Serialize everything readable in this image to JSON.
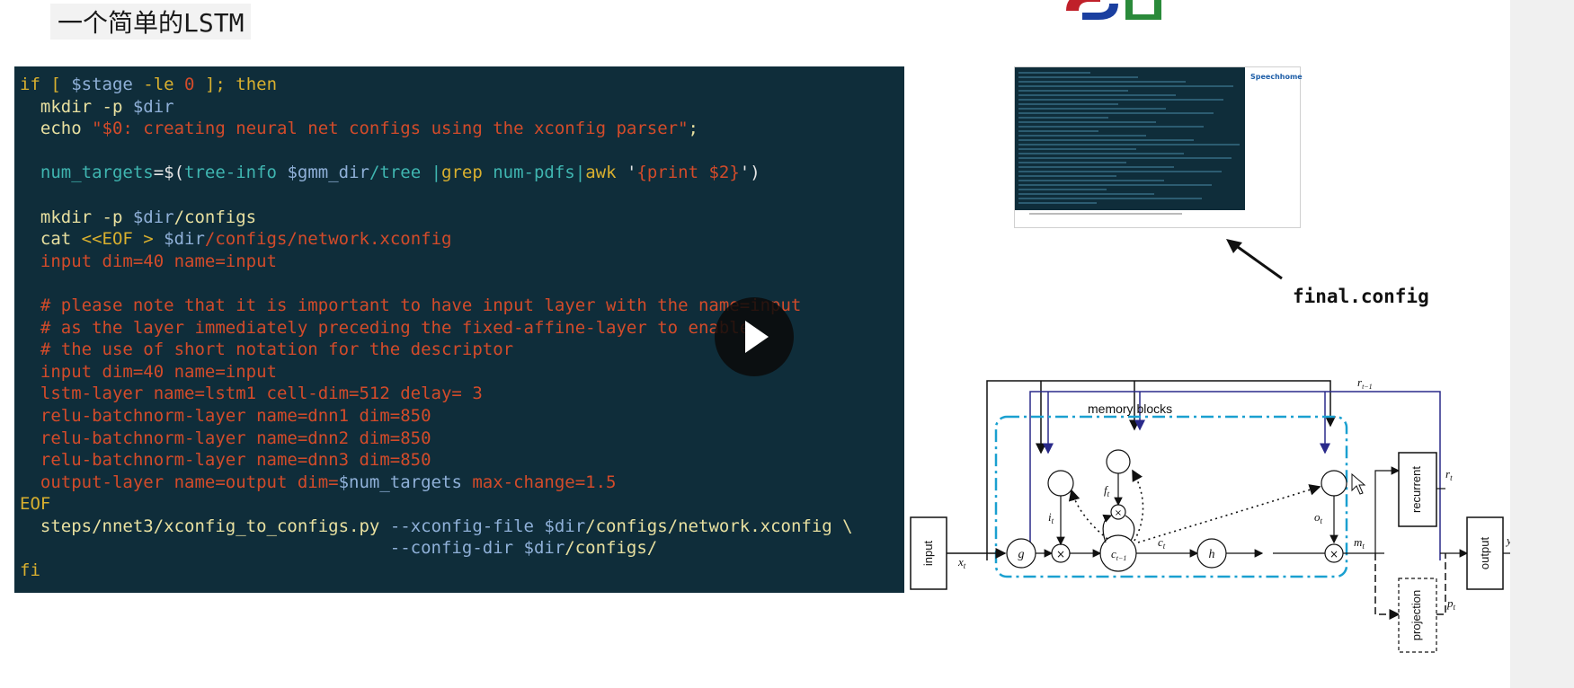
{
  "slide": {
    "title": "一个简单的LSTM"
  },
  "code_lines": [
    [
      {
        "t": "if [ ",
        "c": "kw"
      },
      {
        "t": "$stage",
        "c": "dir"
      },
      {
        "t": " -le ",
        "c": "kw"
      },
      {
        "t": "0",
        "c": "num"
      },
      {
        "t": " ]; then",
        "c": "kw"
      }
    ],
    [
      {
        "t": "  mkdir -p ",
        "c": "cmd"
      },
      {
        "t": "$dir",
        "c": "dir"
      }
    ],
    [
      {
        "t": "  echo ",
        "c": "cmd"
      },
      {
        "t": "\"$0: creating neural net configs using the xconfig parser\"",
        "c": "str"
      },
      {
        "t": ";",
        "c": "cmd"
      }
    ],
    [
      {
        "t": "",
        "c": "plain"
      }
    ],
    [
      {
        "t": "  num_targets",
        "c": "cy"
      },
      {
        "t": "=$(",
        "c": "wh"
      },
      {
        "t": "tree-info ",
        "c": "cy"
      },
      {
        "t": "$gmm_dir",
        "c": "dir"
      },
      {
        "t": "/tree |",
        "c": "cy"
      },
      {
        "t": "grep",
        "c": "kw"
      },
      {
        "t": " num-pdfs|",
        "c": "cy"
      },
      {
        "t": "awk",
        "c": "kw"
      },
      {
        "t": " '",
        "c": "wh"
      },
      {
        "t": "{print $2}",
        "c": "red"
      },
      {
        "t": "')",
        "c": "wh"
      }
    ],
    [
      {
        "t": "",
        "c": "plain"
      }
    ],
    [
      {
        "t": "  mkdir -p ",
        "c": "cmd"
      },
      {
        "t": "$dir",
        "c": "dir"
      },
      {
        "t": "/configs",
        "c": "cmd"
      }
    ],
    [
      {
        "t": "  cat ",
        "c": "cmd"
      },
      {
        "t": "<<EOF > ",
        "c": "kw"
      },
      {
        "t": "$dir",
        "c": "dir"
      },
      {
        "t": "/configs/network.xconfig",
        "c": "red"
      }
    ],
    [
      {
        "t": "  input dim=40 name=input",
        "c": "red"
      }
    ],
    [
      {
        "t": "",
        "c": "plain"
      }
    ],
    [
      {
        "t": "  # please note that it is important to have input layer with the name=input",
        "c": "red"
      }
    ],
    [
      {
        "t": "  # as the layer immediately preceding the fixed-affine-layer to enable",
        "c": "red"
      }
    ],
    [
      {
        "t": "  # the use of short notation for the descriptor",
        "c": "red"
      }
    ],
    [
      {
        "t": "  input dim=40 name=input",
        "c": "red"
      }
    ],
    [
      {
        "t": "  lstm-layer name=lstm1 cell-dim=512 delay= 3",
        "c": "red"
      }
    ],
    [
      {
        "t": "  relu-batchnorm-layer name=dnn1 dim=850",
        "c": "red"
      }
    ],
    [
      {
        "t": "  relu-batchnorm-layer name=dnn2 dim=850",
        "c": "red"
      }
    ],
    [
      {
        "t": "  relu-batchnorm-layer name=dnn3 dim=850",
        "c": "red"
      }
    ],
    [
      {
        "t": "  output-layer name=output dim=",
        "c": "red"
      },
      {
        "t": "$num_targets",
        "c": "dir"
      },
      {
        "t": " max-change=1.5",
        "c": "red"
      }
    ],
    [
      {
        "t": "EOF",
        "c": "kw"
      }
    ],
    [
      {
        "t": "  steps/nnet3/xconfig_to_configs.py ",
        "c": "cmd"
      },
      {
        "t": "--xconfig-file ",
        "c": "dir"
      },
      {
        "t": "$dir",
        "c": "dir"
      },
      {
        "t": "/configs/network.xconfig \\",
        "c": "cmd"
      }
    ],
    [
      {
        "t": "                                    --config-dir ",
        "c": "dir"
      },
      {
        "t": "$dir",
        "c": "dir"
      },
      {
        "t": "/configs/",
        "c": "cmd"
      }
    ],
    [
      {
        "t": "fi",
        "c": "kw"
      }
    ]
  ],
  "thumbnail": {
    "brand": "Speechhome"
  },
  "annotation": {
    "label": "final.config"
  },
  "diagram": {
    "memory_blocks_label": "memory blocks",
    "input_label": "input",
    "output_label": "output",
    "recurrent_label": "recurrent",
    "projection_label": "projection",
    "g_label": "g",
    "h_label": "h",
    "c_prev_label": "c",
    "c_prev_sub": "t−1",
    "ct_label": "c",
    "ct_sub": "t",
    "it_label": "i",
    "it_sub": "t",
    "ft_label": "f",
    "ft_sub": "t",
    "ot_label": "o",
    "ot_sub": "t",
    "xt_label": "x",
    "xt_sub": "t",
    "mt_label": "m",
    "mt_sub": "t",
    "rt_label": "r",
    "rt_sub": "t",
    "rt1_label": "r",
    "rt1_sub": "t−1",
    "pt_label": "p",
    "pt_sub": "t",
    "yt_label": "y",
    "yt_sub": "t",
    "times_symbol": "×"
  },
  "player": {
    "play_icon": "play-icon"
  }
}
